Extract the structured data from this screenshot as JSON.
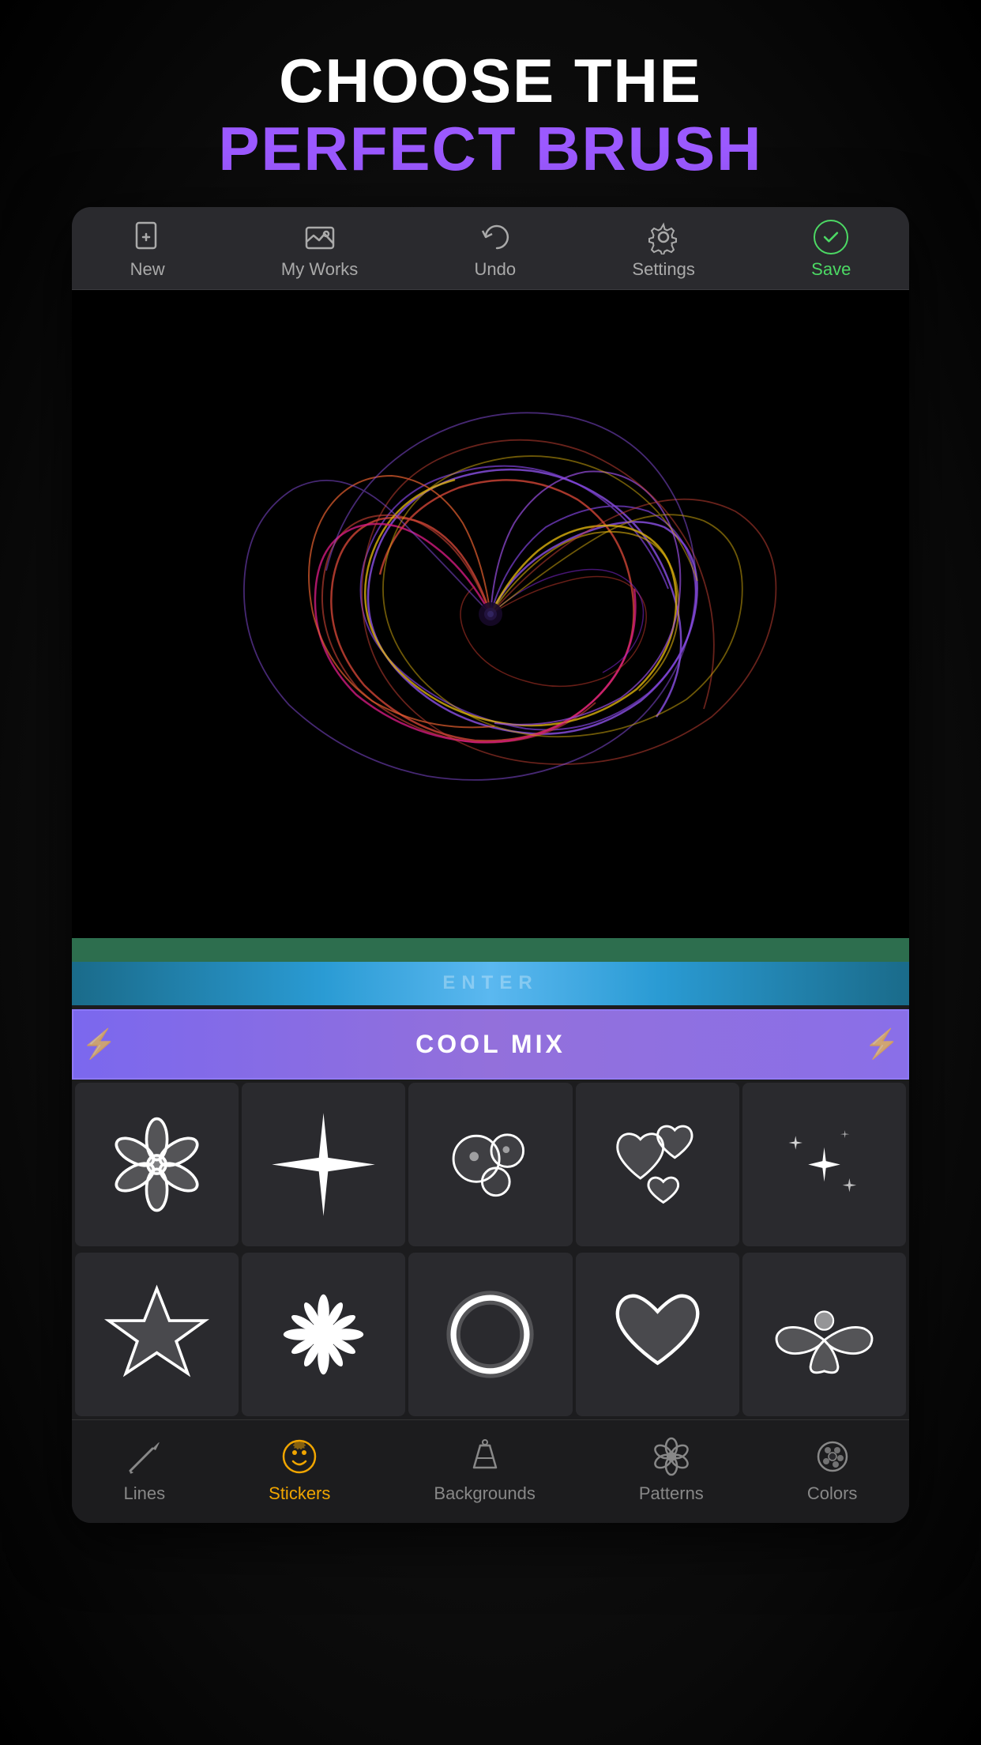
{
  "header": {
    "line1": "CHOOSE THE",
    "line2": "PERFECT BRUSH"
  },
  "toolbar": {
    "items": [
      {
        "id": "new",
        "label": "New",
        "icon": "new-doc"
      },
      {
        "id": "my-works",
        "label": "My Works",
        "icon": "gallery"
      },
      {
        "id": "undo",
        "label": "Undo",
        "icon": "undo"
      },
      {
        "id": "settings",
        "label": "Settings",
        "icon": "gear"
      },
      {
        "id": "save",
        "label": "Save",
        "icon": "checkmark"
      }
    ]
  },
  "banner": {
    "dimText": "ENTER",
    "coolMixLabel": "COOL MIX"
  },
  "brushRows": [
    [
      "flower",
      "sparkle-4",
      "bubbles",
      "hearts",
      "sparkle-small"
    ],
    [
      "star",
      "splat",
      "circle",
      "heart",
      "wings"
    ]
  ],
  "bottomNav": {
    "items": [
      {
        "id": "lines",
        "label": "Lines",
        "icon": "brush",
        "active": false
      },
      {
        "id": "stickers",
        "label": "Stickers",
        "icon": "sticker",
        "active": true
      },
      {
        "id": "backgrounds",
        "label": "Backgrounds",
        "icon": "bucket",
        "active": false
      },
      {
        "id": "patterns",
        "label": "Patterns",
        "icon": "flower",
        "active": false
      },
      {
        "id": "colors",
        "label": "Colors",
        "icon": "palette",
        "active": false
      }
    ]
  }
}
